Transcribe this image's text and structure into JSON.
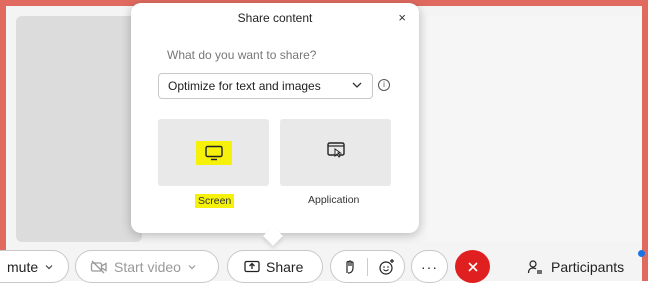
{
  "popup": {
    "title": "Share content",
    "close": "×",
    "question": "What do you want to share?",
    "optimize_select": "Optimize for text and images",
    "options": [
      {
        "label": "Screen",
        "icon": "monitor-icon",
        "highlighted": true
      },
      {
        "label": "Application",
        "icon": "application-window-icon",
        "highlighted": false
      }
    ]
  },
  "toolbar": {
    "mute_label": "mute",
    "start_video_label": "Start video",
    "share_label": "Share",
    "participants_label": "Participants"
  },
  "colors": {
    "frame_border": "#e06a60",
    "highlight": "#f5f10a",
    "end_call": "#e02020",
    "notification_dot": "#1a73e8"
  }
}
